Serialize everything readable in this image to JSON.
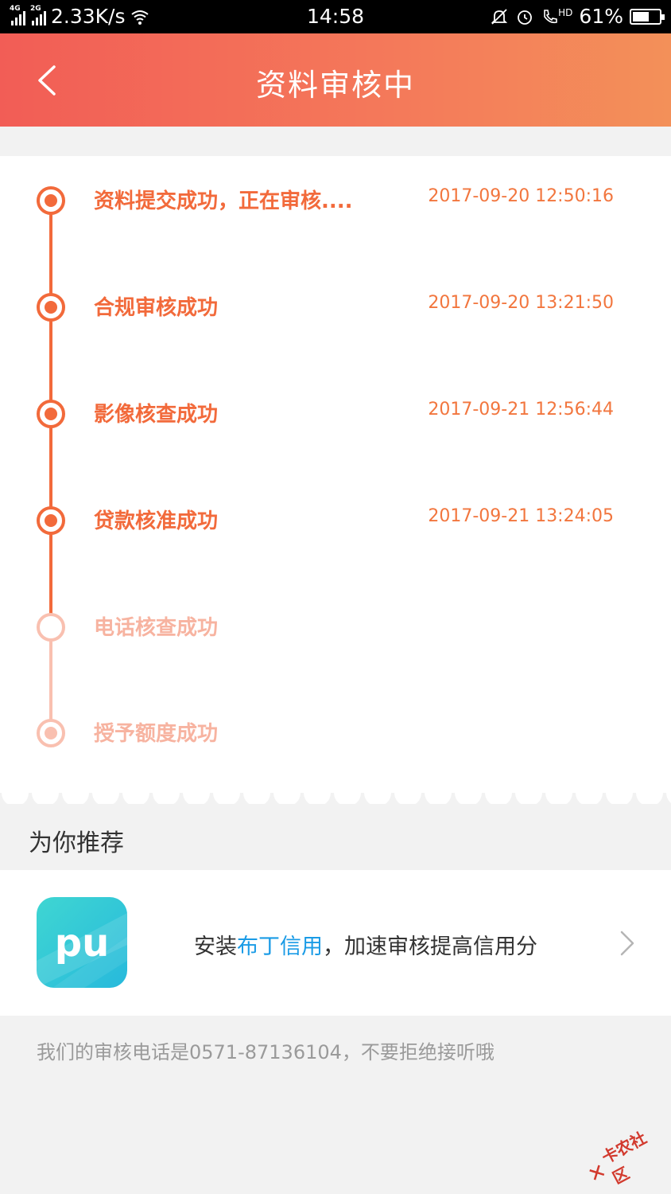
{
  "status_bar": {
    "network1": "4G",
    "network2": "2G",
    "speed": "2.33K/s",
    "time": "14:58",
    "hd": "HD",
    "battery": "61%",
    "battery_level": 0.61
  },
  "header": {
    "title": "资料审核中",
    "back_icon": "chevron-left-icon",
    "background_start": "#f25d56",
    "background_end": "#f39059"
  },
  "timeline": {
    "accent_color": "#f26a3b",
    "pending_color": "#f9c0b0",
    "steps": [
      {
        "label": "资料提交成功，正在审核....",
        "time": "2017-09-20 12:50:16",
        "status": "done"
      },
      {
        "label": "合规审核成功",
        "time": "2017-09-20 13:21:50",
        "status": "done"
      },
      {
        "label": "影像核查成功",
        "time": "2017-09-21 12:56:44",
        "status": "done"
      },
      {
        "label": "贷款核准成功",
        "time": "2017-09-21 13:24:05",
        "status": "done"
      },
      {
        "label": "电话核查成功",
        "time": "",
        "status": "pending"
      },
      {
        "label": "授予额度成功",
        "time": "",
        "status": "pending"
      }
    ]
  },
  "recommend": {
    "title": "为你推荐",
    "app_icon": "pudding-credit-app-icon",
    "app_icon_text": "pu",
    "text_prefix": "安装",
    "app_name": "布丁信用",
    "text_suffix": "，加速审核提高信用分",
    "highlight_color": "#1a9be6",
    "chevron_icon": "chevron-right-icon"
  },
  "footer": {
    "note": "我们的审核电话是0571-87136104，不要拒绝接听哦"
  },
  "watermark": {
    "text": "卡农社区"
  }
}
